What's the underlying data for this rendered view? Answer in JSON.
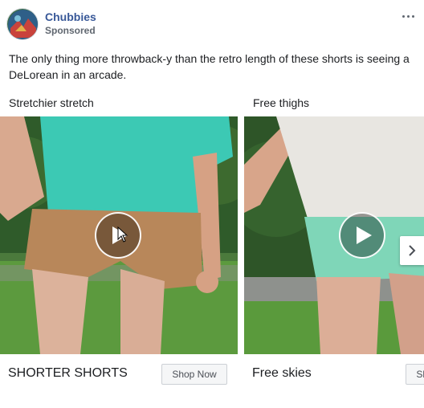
{
  "advertiser": {
    "name": "Chubbies",
    "sponsored": "Sponsored"
  },
  "post": {
    "text": "The only thing more throwback-y than the retro length of these shorts is seeing a DeLorean in an arcade."
  },
  "carousel": {
    "cards": [
      {
        "headline": "Stretchier stretch",
        "title": "SHORTER SHORTS",
        "cta": "Shop Now",
        "media": "video",
        "shorts_color": "#b8875a",
        "shirt_color": "#3cc9b4"
      },
      {
        "headline": "Free thighs",
        "title": "Free skies",
        "cta": "Shop Now",
        "media": "video",
        "shorts_color": "#7fd6b8",
        "shirt_color": "#e8e6e1"
      }
    ]
  },
  "icons": {
    "more": "more-options-icon",
    "play": "play-icon",
    "next": "chevron-right-icon",
    "cursor": "mouse-cursor-icon"
  },
  "colors": {
    "link": "#385898",
    "meta": "#606770",
    "text": "#1c1e21"
  }
}
